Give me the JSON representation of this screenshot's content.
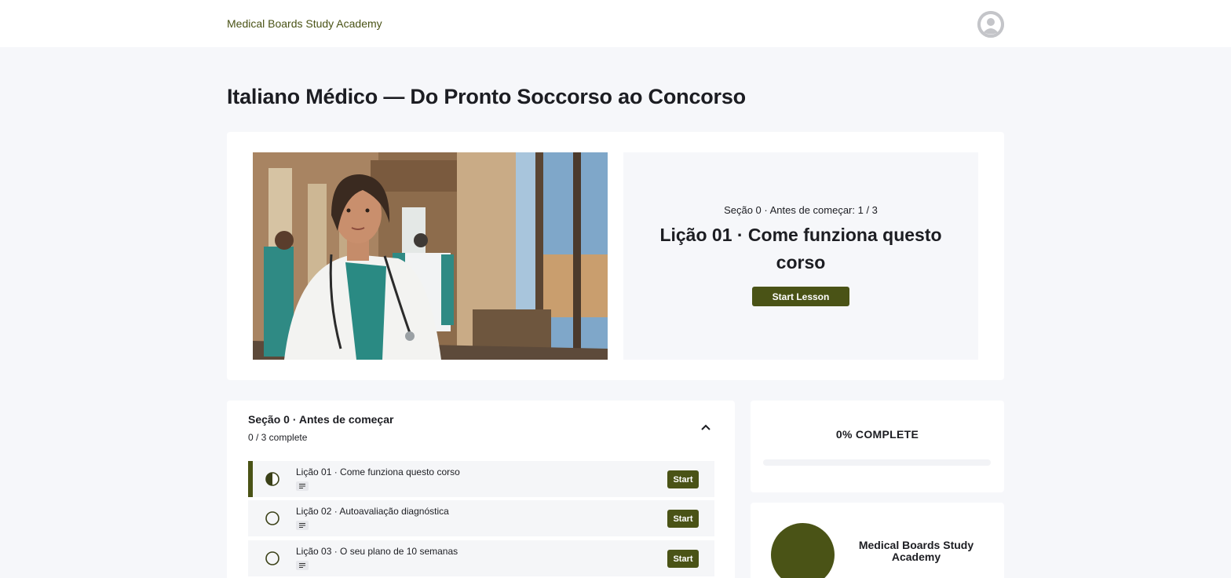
{
  "header": {
    "brand": "Medical Boards Study Academy",
    "avatar_icon": "user-avatar-icon"
  },
  "course": {
    "title": "Italiano Médico — Do Pronto Soccorso ao Concorso"
  },
  "next_lesson": {
    "section_progress": "Seção 0 · Antes de começar: 1 / 3",
    "title": "Lição 01 · Come funziona questo corso",
    "button_label": "Start Lesson"
  },
  "section": {
    "title": "Seção 0 · Antes de começar",
    "count": "0 / 3 complete",
    "toggle_icon": "chevron-up-icon",
    "lessons": [
      {
        "label": "Lição 01 · Come funziona questo corso",
        "status": "in-progress",
        "type_icon": "text-lesson-icon",
        "button_label": "Start"
      },
      {
        "label": "Lição 02 · Autoavaliação diagnóstica",
        "status": "not-started",
        "type_icon": "text-lesson-icon",
        "button_label": "Start"
      },
      {
        "label": "Lição 03 · O seu plano de 10 semanas",
        "status": "not-started",
        "type_icon": "text-lesson-icon",
        "button_label": "Start"
      }
    ]
  },
  "progress": {
    "label": "0% COMPLETE",
    "percent": 0
  },
  "academy": {
    "name": "Medical Boards Study Academy"
  },
  "colors": {
    "accent": "#4a5316",
    "page_background": "#f6f7fa",
    "card_background": "#ffffff"
  }
}
